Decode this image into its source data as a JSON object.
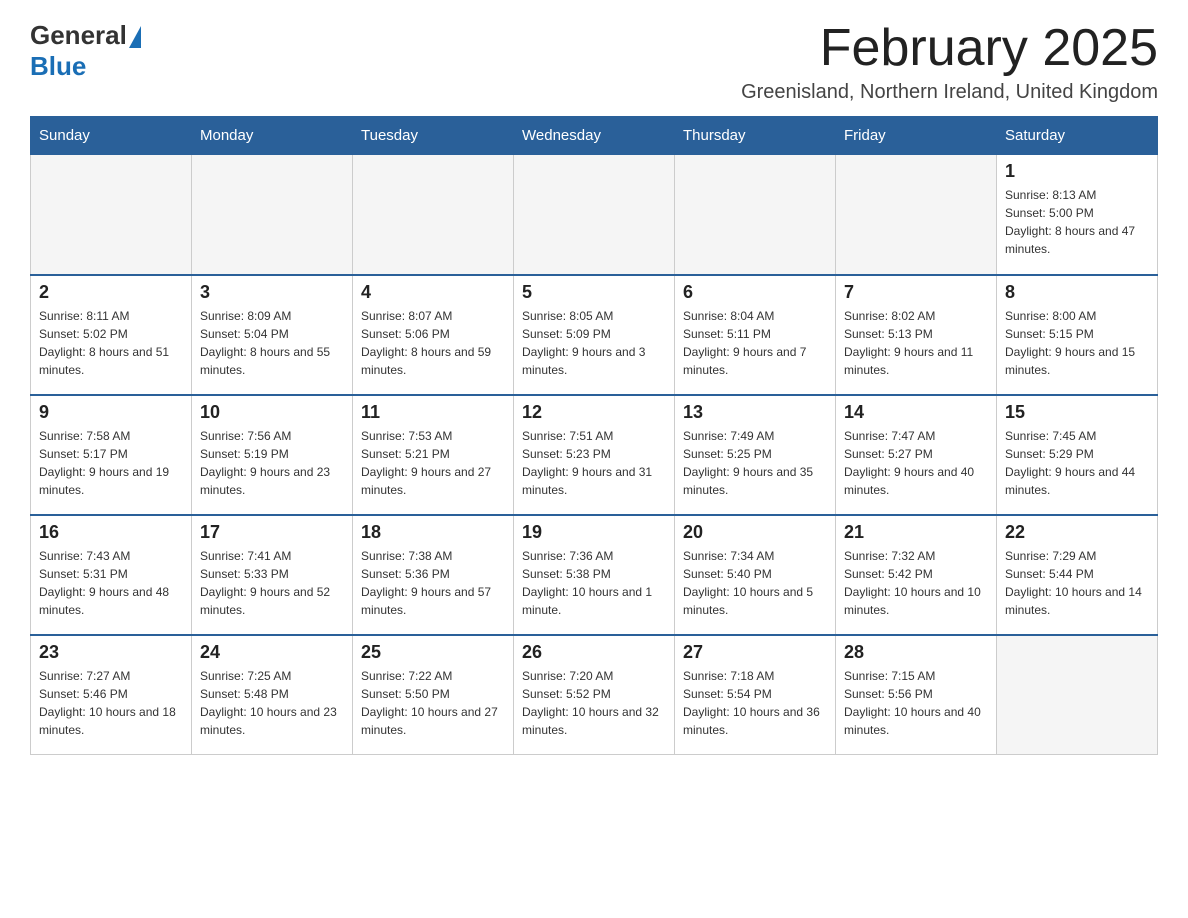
{
  "header": {
    "title": "February 2025",
    "location": "Greenisland, Northern Ireland, United Kingdom"
  },
  "logo": {
    "general": "General",
    "blue": "Blue"
  },
  "days_of_week": [
    "Sunday",
    "Monday",
    "Tuesday",
    "Wednesday",
    "Thursday",
    "Friday",
    "Saturday"
  ],
  "weeks": [
    [
      {
        "date": "",
        "empty": true
      },
      {
        "date": "",
        "empty": true
      },
      {
        "date": "",
        "empty": true
      },
      {
        "date": "",
        "empty": true
      },
      {
        "date": "",
        "empty": true
      },
      {
        "date": "",
        "empty": true
      },
      {
        "date": "1",
        "sunrise": "Sunrise: 8:13 AM",
        "sunset": "Sunset: 5:00 PM",
        "daylight": "Daylight: 8 hours and 47 minutes."
      }
    ],
    [
      {
        "date": "2",
        "sunrise": "Sunrise: 8:11 AM",
        "sunset": "Sunset: 5:02 PM",
        "daylight": "Daylight: 8 hours and 51 minutes."
      },
      {
        "date": "3",
        "sunrise": "Sunrise: 8:09 AM",
        "sunset": "Sunset: 5:04 PM",
        "daylight": "Daylight: 8 hours and 55 minutes."
      },
      {
        "date": "4",
        "sunrise": "Sunrise: 8:07 AM",
        "sunset": "Sunset: 5:06 PM",
        "daylight": "Daylight: 8 hours and 59 minutes."
      },
      {
        "date": "5",
        "sunrise": "Sunrise: 8:05 AM",
        "sunset": "Sunset: 5:09 PM",
        "daylight": "Daylight: 9 hours and 3 minutes."
      },
      {
        "date": "6",
        "sunrise": "Sunrise: 8:04 AM",
        "sunset": "Sunset: 5:11 PM",
        "daylight": "Daylight: 9 hours and 7 minutes."
      },
      {
        "date": "7",
        "sunrise": "Sunrise: 8:02 AM",
        "sunset": "Sunset: 5:13 PM",
        "daylight": "Daylight: 9 hours and 11 minutes."
      },
      {
        "date": "8",
        "sunrise": "Sunrise: 8:00 AM",
        "sunset": "Sunset: 5:15 PM",
        "daylight": "Daylight: 9 hours and 15 minutes."
      }
    ],
    [
      {
        "date": "9",
        "sunrise": "Sunrise: 7:58 AM",
        "sunset": "Sunset: 5:17 PM",
        "daylight": "Daylight: 9 hours and 19 minutes."
      },
      {
        "date": "10",
        "sunrise": "Sunrise: 7:56 AM",
        "sunset": "Sunset: 5:19 PM",
        "daylight": "Daylight: 9 hours and 23 minutes."
      },
      {
        "date": "11",
        "sunrise": "Sunrise: 7:53 AM",
        "sunset": "Sunset: 5:21 PM",
        "daylight": "Daylight: 9 hours and 27 minutes."
      },
      {
        "date": "12",
        "sunrise": "Sunrise: 7:51 AM",
        "sunset": "Sunset: 5:23 PM",
        "daylight": "Daylight: 9 hours and 31 minutes."
      },
      {
        "date": "13",
        "sunrise": "Sunrise: 7:49 AM",
        "sunset": "Sunset: 5:25 PM",
        "daylight": "Daylight: 9 hours and 35 minutes."
      },
      {
        "date": "14",
        "sunrise": "Sunrise: 7:47 AM",
        "sunset": "Sunset: 5:27 PM",
        "daylight": "Daylight: 9 hours and 40 minutes."
      },
      {
        "date": "15",
        "sunrise": "Sunrise: 7:45 AM",
        "sunset": "Sunset: 5:29 PM",
        "daylight": "Daylight: 9 hours and 44 minutes."
      }
    ],
    [
      {
        "date": "16",
        "sunrise": "Sunrise: 7:43 AM",
        "sunset": "Sunset: 5:31 PM",
        "daylight": "Daylight: 9 hours and 48 minutes."
      },
      {
        "date": "17",
        "sunrise": "Sunrise: 7:41 AM",
        "sunset": "Sunset: 5:33 PM",
        "daylight": "Daylight: 9 hours and 52 minutes."
      },
      {
        "date": "18",
        "sunrise": "Sunrise: 7:38 AM",
        "sunset": "Sunset: 5:36 PM",
        "daylight": "Daylight: 9 hours and 57 minutes."
      },
      {
        "date": "19",
        "sunrise": "Sunrise: 7:36 AM",
        "sunset": "Sunset: 5:38 PM",
        "daylight": "Daylight: 10 hours and 1 minute."
      },
      {
        "date": "20",
        "sunrise": "Sunrise: 7:34 AM",
        "sunset": "Sunset: 5:40 PM",
        "daylight": "Daylight: 10 hours and 5 minutes."
      },
      {
        "date": "21",
        "sunrise": "Sunrise: 7:32 AM",
        "sunset": "Sunset: 5:42 PM",
        "daylight": "Daylight: 10 hours and 10 minutes."
      },
      {
        "date": "22",
        "sunrise": "Sunrise: 7:29 AM",
        "sunset": "Sunset: 5:44 PM",
        "daylight": "Daylight: 10 hours and 14 minutes."
      }
    ],
    [
      {
        "date": "23",
        "sunrise": "Sunrise: 7:27 AM",
        "sunset": "Sunset: 5:46 PM",
        "daylight": "Daylight: 10 hours and 18 minutes."
      },
      {
        "date": "24",
        "sunrise": "Sunrise: 7:25 AM",
        "sunset": "Sunset: 5:48 PM",
        "daylight": "Daylight: 10 hours and 23 minutes."
      },
      {
        "date": "25",
        "sunrise": "Sunrise: 7:22 AM",
        "sunset": "Sunset: 5:50 PM",
        "daylight": "Daylight: 10 hours and 27 minutes."
      },
      {
        "date": "26",
        "sunrise": "Sunrise: 7:20 AM",
        "sunset": "Sunset: 5:52 PM",
        "daylight": "Daylight: 10 hours and 32 minutes."
      },
      {
        "date": "27",
        "sunrise": "Sunrise: 7:18 AM",
        "sunset": "Sunset: 5:54 PM",
        "daylight": "Daylight: 10 hours and 36 minutes."
      },
      {
        "date": "28",
        "sunrise": "Sunrise: 7:15 AM",
        "sunset": "Sunset: 5:56 PM",
        "daylight": "Daylight: 10 hours and 40 minutes."
      },
      {
        "date": "",
        "empty": true
      }
    ]
  ]
}
